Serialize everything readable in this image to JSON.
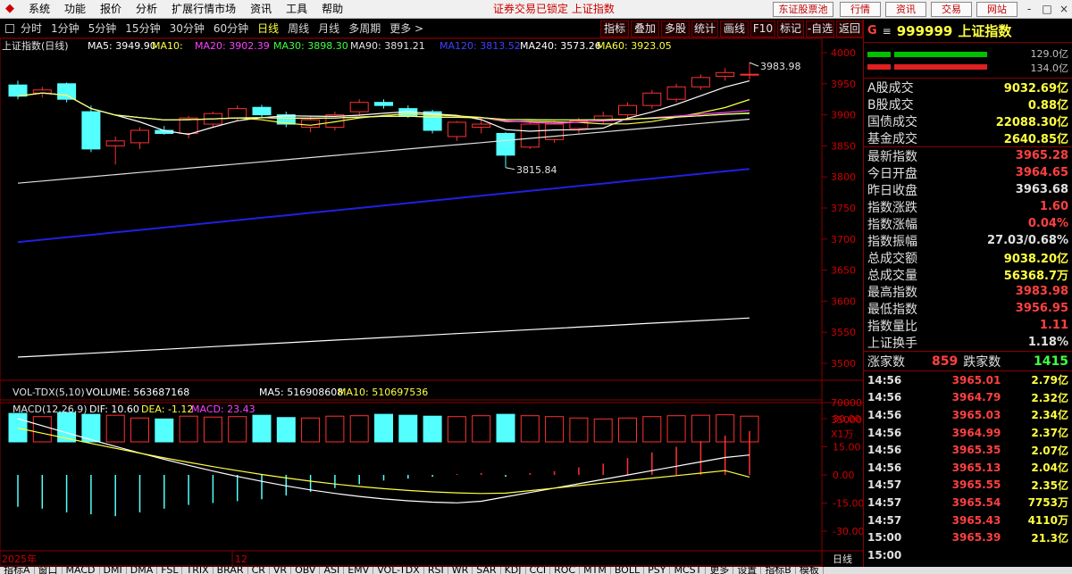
{
  "menubar": {
    "items": [
      "系统",
      "功能",
      "报价",
      "分析",
      "扩展行情市场",
      "资讯",
      "工具",
      "帮助"
    ],
    "notice": "证券交易已锁定 上证指数",
    "broker_button": "东证股票池",
    "right_buttons": [
      "行情",
      "资讯",
      "交易",
      "网站"
    ],
    "window_buttons": [
      "-",
      "□",
      "×"
    ]
  },
  "toolbar": {
    "periods": [
      "分时",
      "1分钟",
      "5分钟",
      "15分钟",
      "30分钟",
      "60分钟",
      "日线",
      "周线",
      "月线",
      "多周期",
      "更多 >"
    ],
    "active_period": "日线",
    "right_buttons": [
      "指标",
      "叠加",
      "多股",
      "统计",
      "画线",
      "F10",
      "标记",
      "-自选",
      "返回"
    ]
  },
  "chart": {
    "title": "上证指数(日线)",
    "ma_labels": [
      {
        "text": "MA5: 3949.90",
        "color": "#ffffff"
      },
      {
        "text": "MA10:",
        "color": "#ffff40"
      },
      {
        "text": "MA20: 3902.39",
        "color": "#ff40ff"
      },
      {
        "text": "MA30: 3898.30",
        "color": "#40ff40"
      },
      {
        "text": "MA90: 3891.21",
        "color": "#e0e0e0"
      },
      {
        "text": "MA120: 3813.52",
        "color": "#4040ff"
      },
      {
        "text": "MA240: 3573.26",
        "color": "#ffffff"
      },
      {
        "text": "MA60: 3923.05",
        "color": "#ffff40"
      }
    ],
    "high_mark": "3983.98",
    "low_mark": "3815.84",
    "price_axis": [
      "4000",
      "3950",
      "3900",
      "3850",
      "3800",
      "3750",
      "3700",
      "3650",
      "3600",
      "3550",
      "3500"
    ],
    "vol_title": "VOL-TDX(5,10)",
    "vol_labels": [
      {
        "text": "VOLUME: 563687168",
        "color": "#ffffff"
      },
      {
        "text": "MA5: 516908608",
        "color": "#ffffff"
      },
      {
        "text": "MA10: 510697536",
        "color": "#ffff40"
      }
    ],
    "vol_axis": [
      "70000",
      "35000",
      "X1万"
    ],
    "macd_title": "MACD(12,26,9)",
    "macd_labels": [
      {
        "text": "DIF: 10.60",
        "color": "#ffffff"
      },
      {
        "text": "DEA: -1.12",
        "color": "#ffff40"
      },
      {
        "text": "MACD: 23.43",
        "color": "#ff40ff"
      }
    ],
    "macd_axis": [
      "30.00",
      "15.00",
      "0.00",
      "-15.00",
      "-30.00"
    ],
    "date_left": "2025年",
    "date_mid": "12",
    "period_tag": "日线"
  },
  "candles": [
    {
      "o": 3948,
      "h": 3955,
      "l": 3925,
      "c": 3930
    },
    {
      "o": 3935,
      "h": 3945,
      "l": 3928,
      "c": 3940
    },
    {
      "o": 3950,
      "h": 3952,
      "l": 3920,
      "c": 3925
    },
    {
      "o": 3905,
      "h": 3915,
      "l": 3840,
      "c": 3845
    },
    {
      "o": 3850,
      "h": 3865,
      "l": 3820,
      "c": 3858
    },
    {
      "o": 3855,
      "h": 3880,
      "l": 3845,
      "c": 3875
    },
    {
      "o": 3875,
      "h": 3882,
      "l": 3868,
      "c": 3870
    },
    {
      "o": 3870,
      "h": 3898,
      "l": 3862,
      "c": 3895
    },
    {
      "o": 3885,
      "h": 3905,
      "l": 3880,
      "c": 3902
    },
    {
      "o": 3895,
      "h": 3915,
      "l": 3890,
      "c": 3910
    },
    {
      "o": 3912,
      "h": 3916,
      "l": 3895,
      "c": 3900
    },
    {
      "o": 3900,
      "h": 3905,
      "l": 3880,
      "c": 3885
    },
    {
      "o": 3880,
      "h": 3898,
      "l": 3872,
      "c": 3892
    },
    {
      "o": 3880,
      "h": 3905,
      "l": 3875,
      "c": 3900
    },
    {
      "o": 3905,
      "h": 3925,
      "l": 3898,
      "c": 3920
    },
    {
      "o": 3920,
      "h": 3925,
      "l": 3910,
      "c": 3915
    },
    {
      "o": 3910,
      "h": 3915,
      "l": 3895,
      "c": 3898
    },
    {
      "o": 3905,
      "h": 3908,
      "l": 3870,
      "c": 3875
    },
    {
      "o": 3865,
      "h": 3890,
      "l": 3858,
      "c": 3888
    },
    {
      "o": 3880,
      "h": 3895,
      "l": 3870,
      "c": 3885
    },
    {
      "o": 3870,
      "h": 3872,
      "l": 3815,
      "c": 3835
    },
    {
      "o": 3848,
      "h": 3888,
      "l": 3845,
      "c": 3885
    },
    {
      "o": 3860,
      "h": 3890,
      "l": 3855,
      "c": 3885
    },
    {
      "o": 3878,
      "h": 3895,
      "l": 3870,
      "c": 3890
    },
    {
      "o": 3892,
      "h": 3905,
      "l": 3885,
      "c": 3898
    },
    {
      "o": 3900,
      "h": 3920,
      "l": 3895,
      "c": 3915
    },
    {
      "o": 3915,
      "h": 3940,
      "l": 3910,
      "c": 3935
    },
    {
      "o": 3925,
      "h": 3950,
      "l": 3920,
      "c": 3945
    },
    {
      "o": 3945,
      "h": 3965,
      "l": 3940,
      "c": 3960
    },
    {
      "o": 3962,
      "h": 3975,
      "l": 3955,
      "c": 3968
    },
    {
      "o": 3964.65,
      "h": 3983.98,
      "l": 3956.95,
      "c": 3965.28
    }
  ],
  "volumes": [
    62,
    55,
    64,
    60,
    58,
    52,
    50,
    56,
    54,
    55,
    58,
    53,
    52,
    56,
    57,
    60,
    58,
    56,
    55,
    57,
    60,
    57,
    55,
    52,
    50,
    52,
    55,
    57,
    58,
    59,
    56
  ],
  "macd_hist": [
    -17,
    -18,
    -20,
    -21,
    -22,
    -20,
    -18,
    -16,
    -15,
    -14,
    -13,
    -11,
    -9,
    -7,
    -5,
    -3,
    -2,
    -1,
    0.5,
    1,
    -1,
    1,
    2,
    4,
    6,
    9,
    12,
    15,
    18,
    21,
    23.43
  ],
  "panel": {
    "marker": "G",
    "eq": "≡",
    "code": "999999",
    "name": "上证指数",
    "bar_top_val": "129.0亿",
    "bar_bot_val": "134.0亿",
    "turnover": [
      {
        "label": "A股成交",
        "value": "9032.69亿"
      },
      {
        "label": "B股成交",
        "value": "0.88亿"
      },
      {
        "label": "国债成交",
        "value": "22088.30亿"
      },
      {
        "label": "基金成交",
        "value": "2640.85亿"
      }
    ],
    "quote": [
      {
        "label": "最新指数",
        "value": "3965.28",
        "color": "#ff4040"
      },
      {
        "label": "今日开盘",
        "value": "3964.65",
        "color": "#ff4040"
      },
      {
        "label": "昨日收盘",
        "value": "3963.68",
        "color": "#e0e0e0"
      },
      {
        "label": "指数涨跌",
        "value": "1.60",
        "color": "#ff4040"
      },
      {
        "label": "指数涨幅",
        "value": "0.04%",
        "color": "#ff4040"
      },
      {
        "label": "指数振幅",
        "value": "27.03/0.68%",
        "color": "#e0e0e0"
      },
      {
        "label": "总成交额",
        "value": "9038.20亿",
        "color": "#ffff40"
      },
      {
        "label": "总成交量",
        "value": "56368.7万",
        "color": "#ffff40"
      },
      {
        "label": "最高指数",
        "value": "3983.98",
        "color": "#ff4040"
      },
      {
        "label": "最低指数",
        "value": "3956.95",
        "color": "#ff4040"
      },
      {
        "label": "指数量比",
        "value": "1.11",
        "color": "#ff4040"
      },
      {
        "label": "上证换手",
        "value": "1.18%",
        "color": "#e0e0e0"
      }
    ],
    "up_label": "涨家数",
    "up_count": "859",
    "down_label": "跌家数",
    "down_count": "1415",
    "ticks": [
      {
        "t": "14:56",
        "p": "3965.01",
        "v": "2.79亿"
      },
      {
        "t": "14:56",
        "p": "3964.79",
        "v": "2.32亿"
      },
      {
        "t": "14:56",
        "p": "3965.03",
        "v": "2.34亿"
      },
      {
        "t": "14:56",
        "p": "3964.99",
        "v": "2.37亿"
      },
      {
        "t": "14:56",
        "p": "3965.35",
        "v": "2.07亿"
      },
      {
        "t": "14:56",
        "p": "3965.13",
        "v": "2.04亿"
      },
      {
        "t": "14:57",
        "p": "3965.55",
        "v": "2.35亿"
      },
      {
        "t": "14:57",
        "p": "3965.54",
        "v": "7753万"
      },
      {
        "t": "14:57",
        "p": "3965.43",
        "v": "4110万"
      },
      {
        "t": "15:00",
        "p": "3965.39",
        "v": "21.3亿"
      },
      {
        "t": "15:00",
        "p": "",
        "v": ""
      }
    ]
  },
  "tabbar": {
    "tabs": [
      "指标A",
      "窗口",
      "MACD",
      "DMI",
      "DMA",
      "FSL",
      "TRIX",
      "BRAR",
      "CR",
      "VR",
      "OBV",
      "ASI",
      "EMV",
      "VOL-TDX",
      "RSI",
      "WR",
      "SAR",
      "KDJ",
      "CCI",
      "ROC",
      "MTM",
      "BOLL",
      "PSY",
      "MCST",
      "更多",
      "设置",
      "指标B",
      "模板"
    ]
  }
}
